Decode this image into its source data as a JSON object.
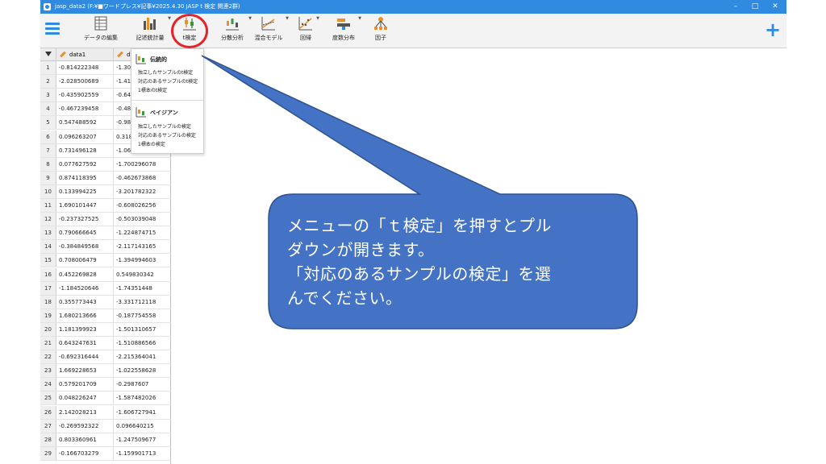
{
  "window": {
    "title": "jasp_data2     (F:¥■ワードプレス¥記事¥2025.4.30   JASP   t 検定   関連2群)",
    "controls": {
      "minimize": "–",
      "maximize": "□",
      "close": "✕"
    }
  },
  "toolbar": {
    "menu_icon": "hamburger-icon",
    "items": [
      {
        "label": "データの編集",
        "icon": "data-editor-icon"
      },
      {
        "label": "記述統計量",
        "icon": "bar-chart-icon"
      },
      {
        "label": "t検定",
        "icon": "t-test-icon"
      },
      {
        "label": "分散分析",
        "icon": "anova-icon"
      },
      {
        "label": "混合モデル",
        "icon": "mixed-model-icon"
      },
      {
        "label": "回帰",
        "icon": "regression-icon"
      },
      {
        "label": "度数分布",
        "icon": "frequency-icon"
      },
      {
        "label": "因子",
        "icon": "factor-icon"
      }
    ],
    "add_icon": "plus-icon"
  },
  "grid": {
    "columns": [
      "data1",
      "data2"
    ],
    "rows": [
      [
        "1",
        "-0.814222348",
        "-1.307022265"
      ],
      [
        "2",
        "-2.028500689",
        "-1.418418103"
      ],
      [
        "3",
        "-0.435902559",
        "-0.64486447"
      ],
      [
        "4",
        "-0.467239458",
        "-0.486518885"
      ],
      [
        "5",
        "0.547488592",
        "-0.9813926"
      ],
      [
        "6",
        "0.096263207",
        "0.318448972"
      ],
      [
        "7",
        "0.731496128",
        "-1.065832"
      ],
      [
        "8",
        "0.077627592",
        "-1.700296078"
      ],
      [
        "9",
        "0.874118395",
        "-0.462673868"
      ],
      [
        "10",
        "0.133994225",
        "-3.201782322"
      ],
      [
        "11",
        "1.690101447",
        "-0.608026256"
      ],
      [
        "12",
        "-0.237327525",
        "-0.503039048"
      ],
      [
        "13",
        "0.790666645",
        "-1.224874715"
      ],
      [
        "14",
        "-0.384849568",
        "-2.117143165"
      ],
      [
        "15",
        "0.708006479",
        "-1.394994603"
      ],
      [
        "16",
        "0.452269828",
        "0.549830342"
      ],
      [
        "17",
        "-1.184520646",
        "-1.74351448"
      ],
      [
        "18",
        "0.355773443",
        "-3.331712118"
      ],
      [
        "19",
        "1.680213666",
        "-0.187754558"
      ],
      [
        "20",
        "1.181399923",
        "-1.501310657"
      ],
      [
        "21",
        "0.643247631",
        "-1.510886566"
      ],
      [
        "22",
        "-0.692316444",
        "-2.215364041"
      ],
      [
        "23",
        "1.669228653",
        "-1.022558628"
      ],
      [
        "24",
        "0.579201709",
        "-0.2987607"
      ],
      [
        "25",
        "0.048226247",
        "-1.587482026"
      ],
      [
        "26",
        "2.142028213",
        "-1.606727941"
      ],
      [
        "27",
        "-0.269592322",
        "0.096640215"
      ],
      [
        "28",
        "0.803360961",
        "-1.247509677"
      ],
      [
        "29",
        "-0.166703279",
        "-1.159901713"
      ]
    ]
  },
  "ttest_menu": {
    "classical": {
      "title": "伝統的",
      "items": [
        "独立したサンプルのt検定",
        "対応のあるサンプルのt検定",
        "1標本のt検定"
      ]
    },
    "bayesian": {
      "title": "ベイジアン",
      "items": [
        "独立したサンプルの検定",
        "対応のあるサンプルの検定",
        "1標本の検定"
      ]
    }
  },
  "callout": {
    "lines": [
      "メニューの「ｔ検定」を押すとプル",
      "ダウンが開きます。",
      "「対応のあるサンプルの検定」を選",
      "んでください。"
    ]
  },
  "colors": {
    "titlebar": "#2f8ae0",
    "callout_fill": "#4472c4",
    "callout_border": "#2f528f",
    "highlight": "#e5232a",
    "accent": "#2f8ae0"
  }
}
